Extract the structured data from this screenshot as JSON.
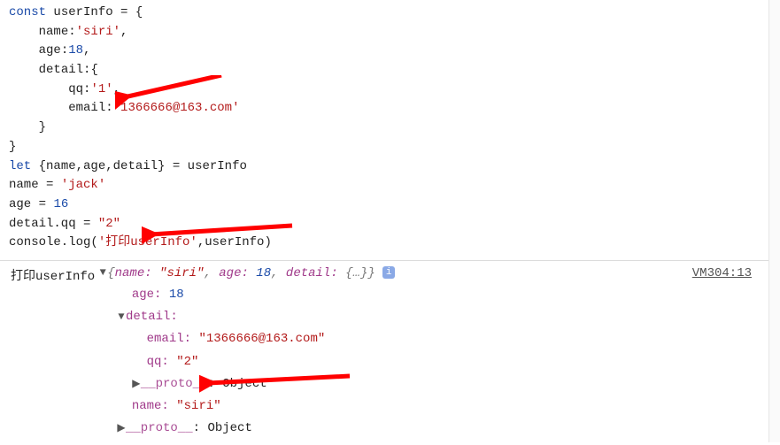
{
  "code": {
    "l1": {
      "kw": "const",
      "id": "userInfo",
      "eq": "=",
      "brace": "{"
    },
    "l2": {
      "prop": "name",
      "val": "'siri'",
      "comma": ","
    },
    "l3": {
      "prop": "age",
      "val": "18",
      "comma": ","
    },
    "l4": {
      "prop": "detail",
      "brace": "{"
    },
    "l5": {
      "prop": "qq",
      "val": "'1'",
      "comma": ","
    },
    "l6": {
      "prop": "email",
      "val": "'1366666@163.com'"
    },
    "l7": {
      "brace": "}"
    },
    "l8": {
      "brace": "}"
    },
    "l9": {
      "kw": "let",
      "destruct": "{name,age,detail}",
      "eq": "=",
      "id": "userInfo"
    },
    "l10": {
      "id": "name",
      "eq": "=",
      "val": "'jack'"
    },
    "l11": {
      "id": "age",
      "eq": "=",
      "val": "16"
    },
    "l12": {
      "id": "detail.qq",
      "eq": "=",
      "val": "\"2\""
    },
    "l13": {
      "fn": "console.log",
      "arg1": "'打印userInfo'",
      "arg2": "userInfo"
    }
  },
  "console": {
    "prefix": "打印userInfo",
    "summary": {
      "open": "{",
      "p1": "name:",
      "v1": "\"siri\"",
      "p2": "age:",
      "v2": "18",
      "p3": "detail:",
      "v3": "{…}",
      "close": "}"
    },
    "info": "i",
    "source": "VM304:13",
    "tree": {
      "age_k": "age:",
      "age_v": "18",
      "detail_k": "detail:",
      "email_k": "email:",
      "email_v": "\"1366666@163.com\"",
      "qq_k": "qq:",
      "qq_v": "\"2\"",
      "proto_k": "__proto__",
      "proto_v": "Object",
      "name_k": "name:",
      "name_v": "\"siri\""
    }
  },
  "annotations": {
    "arrow_color": "#ff0000"
  }
}
